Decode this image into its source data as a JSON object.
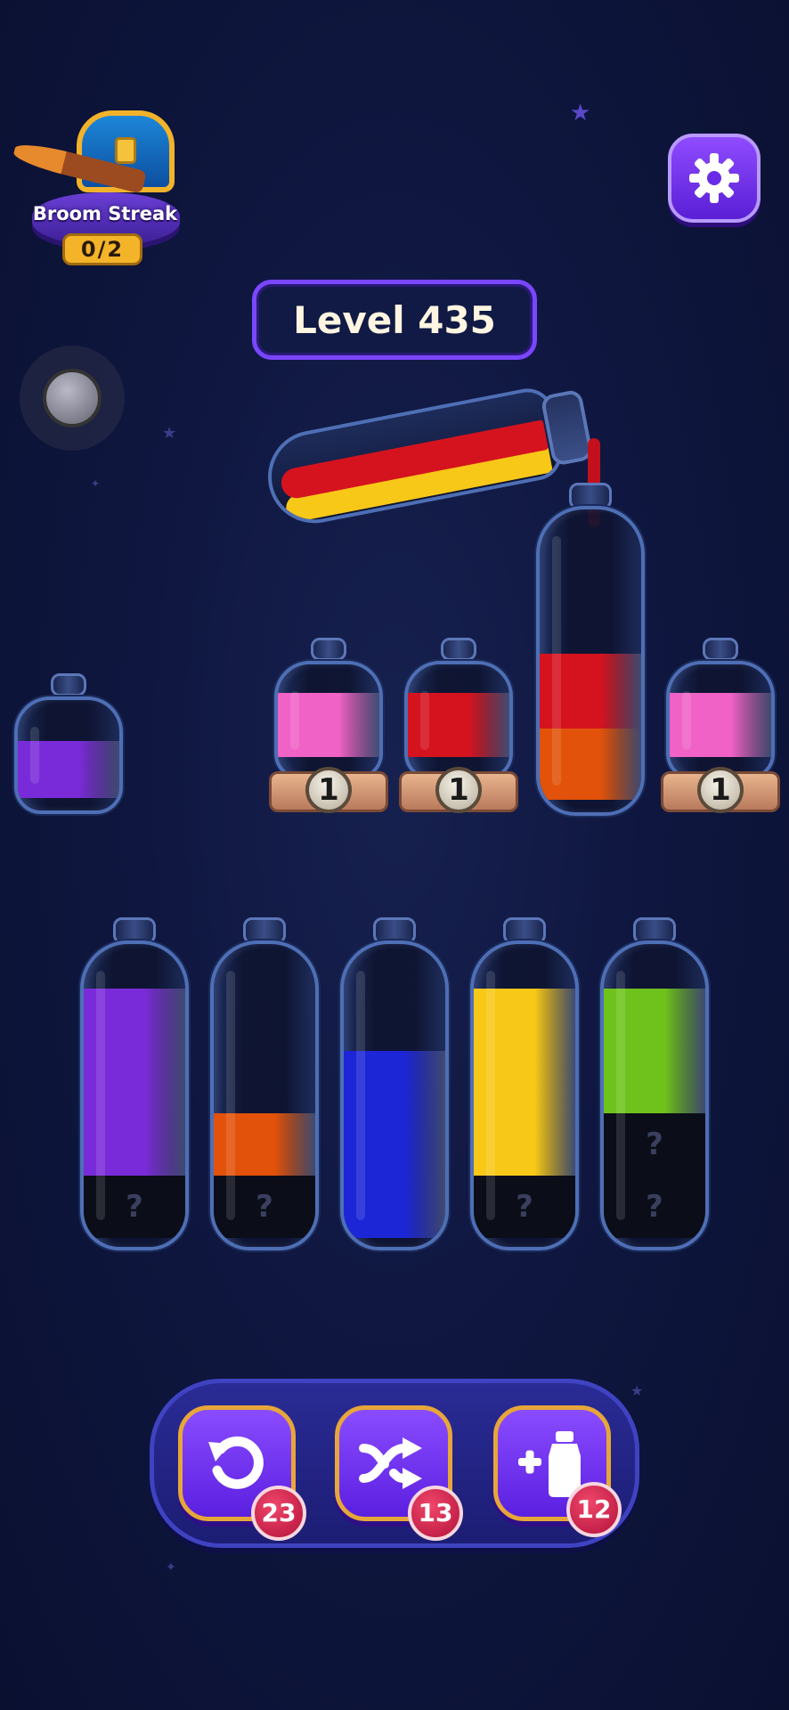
{
  "header": {
    "broom_streak": {
      "title": "Broom Streak",
      "count": "0/2"
    },
    "level_label": "Level 435"
  },
  "bottles_row1": [
    {
      "id": "purple-small",
      "layers": [
        "#7a2bd9"
      ]
    },
    {
      "id": "pink-locked-1",
      "layers": [
        "#f062c6"
      ],
      "lock": "1"
    },
    {
      "id": "red-locked",
      "layers": [
        "#d5131f"
      ],
      "lock": "1"
    },
    {
      "id": "orange-red-target",
      "layers": [
        "#e2520a",
        "#d5131f"
      ]
    },
    {
      "id": "pink-locked-2",
      "layers": [
        "#f062c6"
      ],
      "lock": "1"
    }
  ],
  "pouring_bottle": {
    "layers": [
      "#f7c817",
      "#d5131f"
    ]
  },
  "bottles_row2": [
    {
      "id": "purple-tube",
      "layers": [
        "hidden",
        "#7a2bd9",
        "#7a2bd9",
        "#7a2bd9"
      ]
    },
    {
      "id": "orange-tube",
      "layers": [
        "hidden",
        "#e2520a"
      ]
    },
    {
      "id": "blue-tube",
      "layers": [
        "#1c26d6",
        "#1c26d6",
        "#1c26d6"
      ]
    },
    {
      "id": "yellow-tube",
      "layers": [
        "hidden",
        "#f7c817",
        "#f7c817",
        "#f7c817"
      ]
    },
    {
      "id": "green-tube",
      "layers": [
        "hidden",
        "hidden",
        "#6fc21c",
        "#6fc21c"
      ]
    }
  ],
  "hidden_marker": "?",
  "tools": {
    "undo": {
      "icon": "undo-icon",
      "count": "23"
    },
    "shuffle": {
      "icon": "shuffle-icon",
      "count": "13"
    },
    "add_bottle": {
      "icon": "add-bottle-icon",
      "count": "12"
    }
  },
  "colors": {
    "accent": "#7a46ff",
    "background": "#0f1740"
  }
}
